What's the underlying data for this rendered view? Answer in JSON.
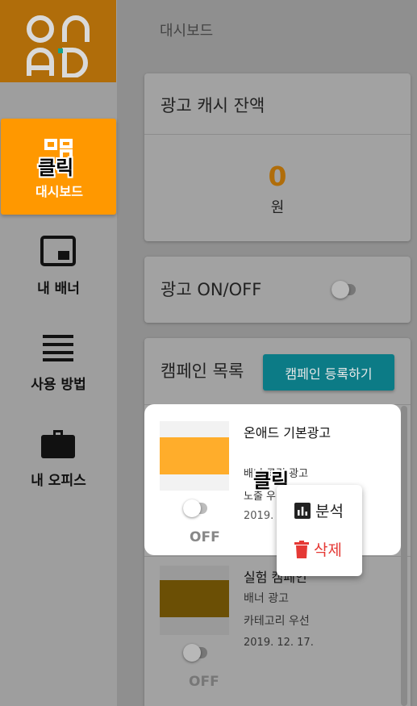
{
  "sidebar": {
    "logo_text": "ONAD",
    "items": [
      {
        "label": "대시보드",
        "icon": "dashboard-icon"
      },
      {
        "label": "내 배너",
        "icon": "banner-icon"
      },
      {
        "label": "사용 방법",
        "icon": "menu-lines-icon"
      },
      {
        "label": "내 오피스",
        "icon": "briefcase-icon"
      }
    ]
  },
  "annotations": {
    "click_1": "클릭",
    "click_2": "클릭"
  },
  "header": {
    "breadcrumb": "대시보드"
  },
  "cash_card": {
    "title": "광고 캐시 잔액",
    "amount": "0",
    "unit": "원"
  },
  "onoff_card": {
    "title": "광고 ON/OFF"
  },
  "campaign_card": {
    "title": "캠페인 목록",
    "register_button": "캠페인 등록하기",
    "items": [
      {
        "name": "온애드 기본광고",
        "type": "배너 클릭 광고",
        "line2": "노출 우",
        "date": "2019.",
        "status": "OFF",
        "thumb_color": "#ffad2b"
      },
      {
        "name": "실험 캠페인",
        "type": "배너 광고",
        "line2": "카테고리 우선",
        "date": "2019. 12. 17.",
        "status": "OFF",
        "thumb_color": "#6b4f05"
      }
    ]
  },
  "context_menu": {
    "analyze": "분석",
    "delete": "삭제"
  },
  "colors": {
    "accent": "#ff9800",
    "button": "#0c7b86",
    "danger": "#e53935",
    "cash": "#b06d0a"
  }
}
